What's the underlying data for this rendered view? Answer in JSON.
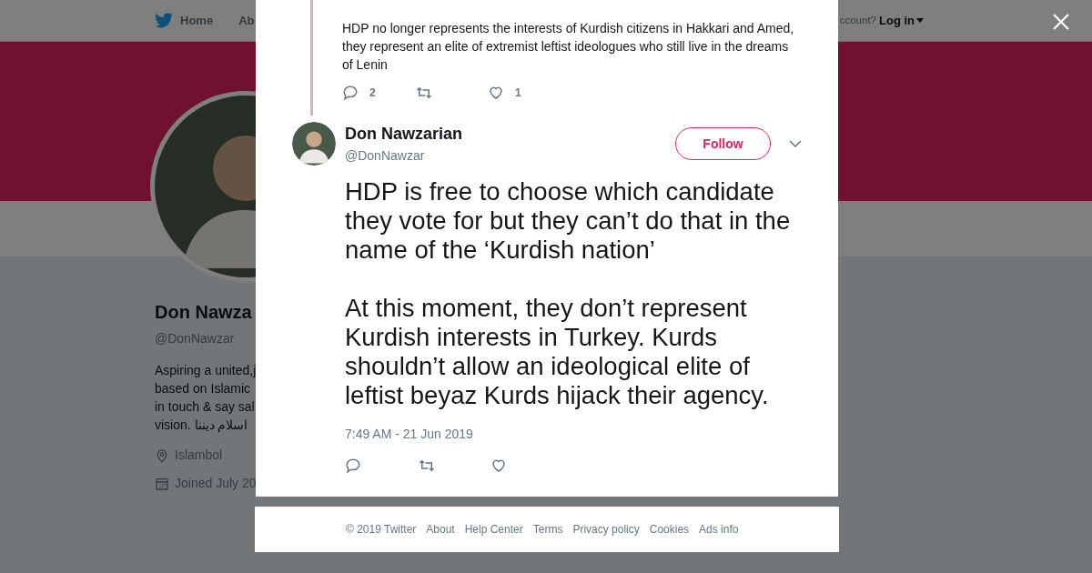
{
  "background_page": {
    "nav": {
      "items": [
        {
          "label": "Home"
        },
        {
          "label": "Ab"
        }
      ],
      "account_prompt": "ccount?",
      "login": "Log in"
    },
    "profile": {
      "name": "Don Nawza",
      "handle": "@DonNawzar",
      "bio_lines": [
        "Aspiring a united,j",
        "based on Islamic",
        "in touch & say sal",
        "vision. اسلام دیننا"
      ],
      "location": "Islambol",
      "joined": "Joined July 20"
    }
  },
  "modal": {
    "parent_tweet": {
      "text": "HDP no longer represents the interests of Kurdish citizens in Hakkari and Amed, they represent an elite of extremist leftist ideologues who still live in the dreams of Lenin",
      "replies": "2",
      "likes": "1"
    },
    "tweet": {
      "name": "Don Nawzarian",
      "handle": "@DonNawzar",
      "follow": "Follow",
      "paragraphs": [
        "HDP is free to choose which candidate they vote for but they can’t do that in the name of the ‘Kurdish nation’",
        "At this moment, they don’t represent Kurdish interests in Turkey. Kurds shouldn’t allow an ideological elite of leftist beyaz Kurds hijack their agency."
      ],
      "timestamp": "7:49 AM - 21 Jun 2019"
    },
    "footer": [
      "© 2019 Twitter",
      "About",
      "Help Center",
      "Terms",
      "Privacy policy",
      "Cookies",
      "Ads info"
    ]
  }
}
